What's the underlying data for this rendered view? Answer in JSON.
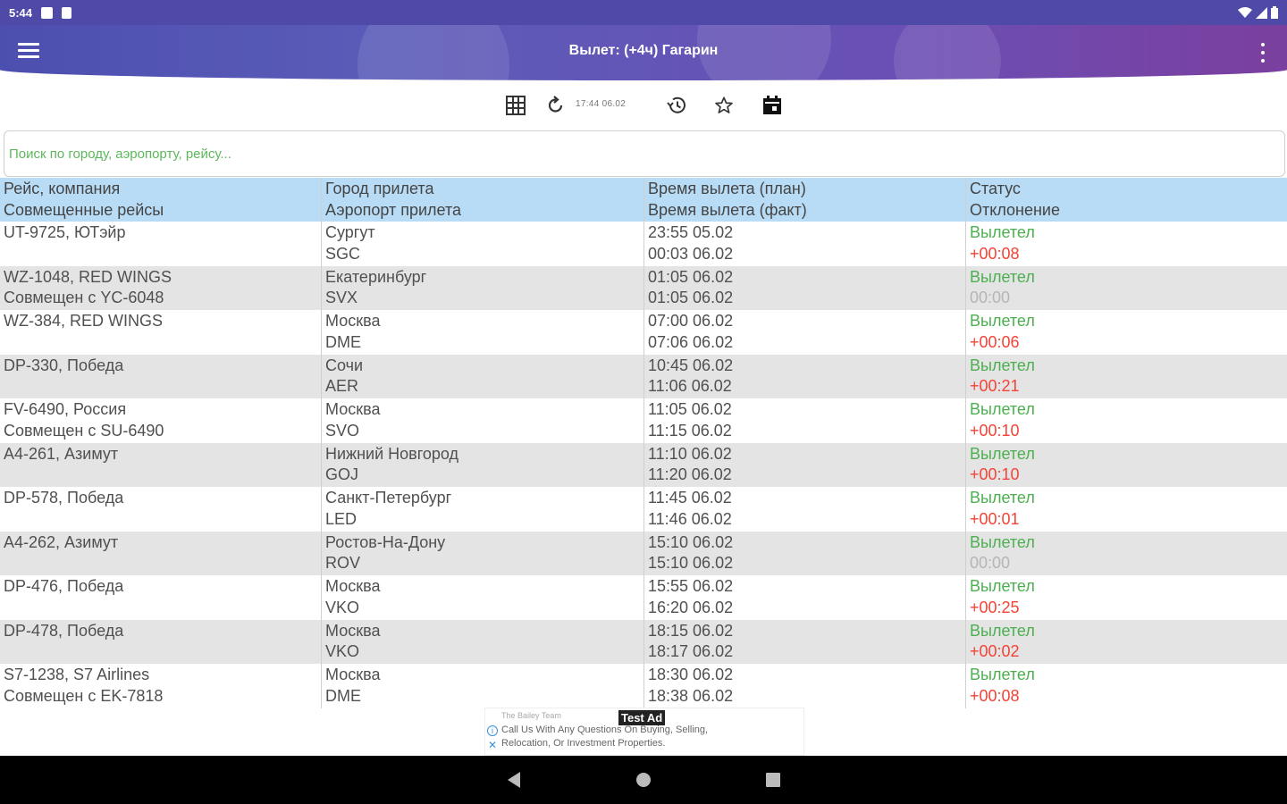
{
  "status_bar": {
    "time": "5:44"
  },
  "app_bar": {
    "title": "Вылет: (+4ч) Гагарин"
  },
  "toolbar": {
    "timestamp": "17:44 06.02"
  },
  "search": {
    "placeholder": "Поиск по городу, аэропорту, рейсу..."
  },
  "table": {
    "headers": [
      {
        "line1": "Рейс, компания",
        "line2": "Совмещенные рейсы"
      },
      {
        "line1": "Город прилета",
        "line2": "Аэропорт прилета"
      },
      {
        "line1": "Время вылета (план)",
        "line2": "Время вылета (факт)"
      },
      {
        "line1": "Статус",
        "line2": "Отклонение"
      }
    ],
    "rows": [
      {
        "flight": "UT-9725, ЮТэйр",
        "codeshare": "",
        "city": "Сургут",
        "airport": "SGC",
        "planned": "23:55 05.02",
        "actual": "00:03 06.02",
        "status": "Вылетел",
        "deviation": "+00:08"
      },
      {
        "flight": "WZ-1048, RED WINGS",
        "codeshare": "Совмещен с YC-6048",
        "city": "Екатеринбург",
        "airport": "SVX",
        "planned": "01:05 06.02",
        "actual": "01:05 06.02",
        "status": "Вылетел",
        "deviation": "00:00"
      },
      {
        "flight": "WZ-384, RED WINGS",
        "codeshare": "",
        "city": "Москва",
        "airport": "DME",
        "planned": "07:00 06.02",
        "actual": "07:06 06.02",
        "status": "Вылетел",
        "deviation": "+00:06"
      },
      {
        "flight": "DP-330, Победа",
        "codeshare": "",
        "city": "Сочи",
        "airport": "AER",
        "planned": "10:45 06.02",
        "actual": "11:06 06.02",
        "status": "Вылетел",
        "deviation": "+00:21"
      },
      {
        "flight": "FV-6490, Россия",
        "codeshare": "Совмещен с SU-6490",
        "city": "Москва",
        "airport": "SVO",
        "planned": "11:05 06.02",
        "actual": "11:15 06.02",
        "status": "Вылетел",
        "deviation": "+00:10"
      },
      {
        "flight": "A4-261, Азимут",
        "codeshare": "",
        "city": "Нижний Новгород",
        "airport": "GOJ",
        "planned": "11:10 06.02",
        "actual": "11:20 06.02",
        "status": "Вылетел",
        "deviation": "+00:10"
      },
      {
        "flight": "DP-578, Победа",
        "codeshare": "",
        "city": "Санкт-Петербург",
        "airport": "LED",
        "planned": "11:45 06.02",
        "actual": "11:46 06.02",
        "status": "Вылетел",
        "deviation": "+00:01"
      },
      {
        "flight": "A4-262, Азимут",
        "codeshare": "",
        "city": "Ростов-На-Дону",
        "airport": "ROV",
        "planned": "15:10 06.02",
        "actual": "15:10 06.02",
        "status": "Вылетел",
        "deviation": "00:00"
      },
      {
        "flight": "DP-476, Победа",
        "codeshare": "",
        "city": "Москва",
        "airport": "VKO",
        "planned": "15:55 06.02",
        "actual": "16:20 06.02",
        "status": "Вылетел",
        "deviation": "+00:25"
      },
      {
        "flight": "DP-478, Победа",
        "codeshare": "",
        "city": "Москва",
        "airport": "VKO",
        "planned": "18:15 06.02",
        "actual": "18:17 06.02",
        "status": "Вылетел",
        "deviation": "+00:02"
      },
      {
        "flight": "S7-1238, S7 Airlines",
        "codeshare": "Совмещен с EK-7818",
        "city": "Москва",
        "airport": "DME",
        "planned": "18:30 06.02",
        "actual": "18:38 06.02",
        "status": "Вылетел",
        "deviation": "+00:08"
      }
    ]
  },
  "ad": {
    "sponsor": "The Bailey Team",
    "badge": "Test Ad",
    "line1": "Call Us With Any Questions On Buying, Selling,",
    "line2": "Relocation, Or Investment Properties."
  },
  "colors": {
    "status_green": "#4caf50",
    "deviation_red": "#f44336",
    "deviation_zero": "#b5b5b5",
    "header_blue": "#b9dcf6",
    "app_bar": "#5b5cb8"
  }
}
